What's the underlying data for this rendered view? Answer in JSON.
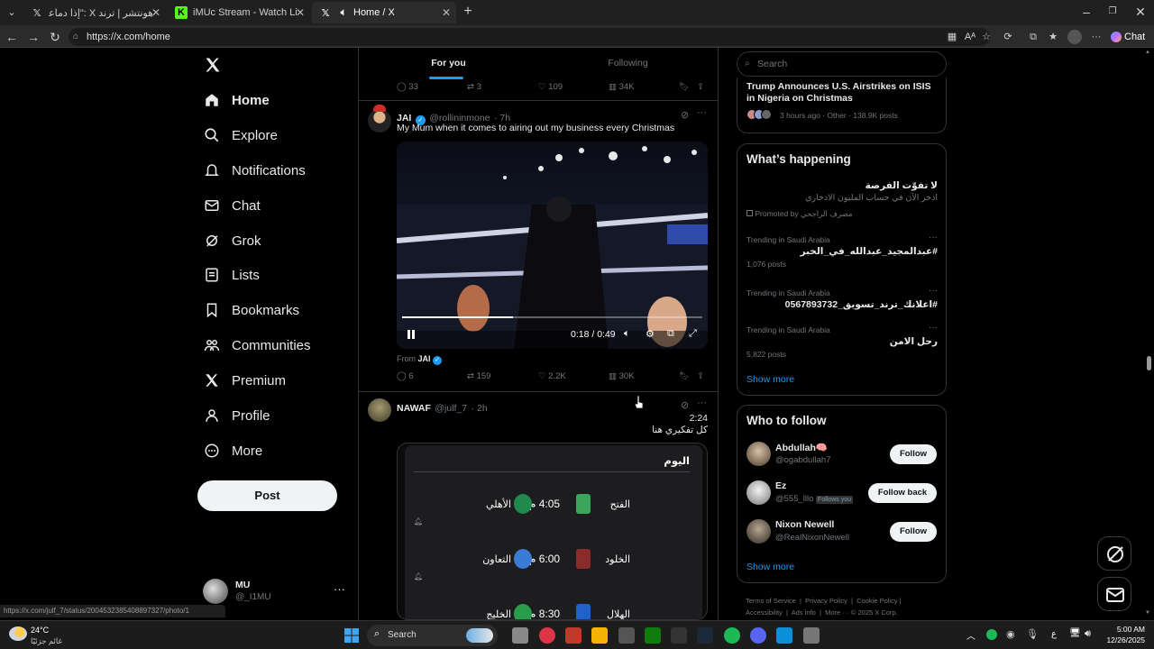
{
  "browser": {
    "tabs": [
      {
        "label": "هونتشر | ترند X :\"إذا دماعك يميز",
        "icon": "X"
      },
      {
        "label": "iMUc Stream - Watch Live on Kick",
        "icon": "K"
      },
      {
        "label": "Home / X",
        "icon": "X"
      }
    ],
    "url": "https://x.com/home",
    "chat_label": "Chat"
  },
  "nav": {
    "items": [
      {
        "label": "Home",
        "icon": "home-icon"
      },
      {
        "label": "Explore",
        "icon": "search-icon"
      },
      {
        "label": "Notifications",
        "icon": "bell-icon"
      },
      {
        "label": "Chat",
        "icon": "mail-icon"
      },
      {
        "label": "Grok",
        "icon": "grok-icon"
      },
      {
        "label": "Lists",
        "icon": "list-icon"
      },
      {
        "label": "Bookmarks",
        "icon": "bookmark-icon"
      },
      {
        "label": "Communities",
        "icon": "people-icon"
      },
      {
        "label": "Premium",
        "icon": "x-logo-icon"
      },
      {
        "label": "Profile",
        "icon": "person-icon"
      },
      {
        "label": "More",
        "icon": "more-circle-icon"
      }
    ],
    "post_label": "Post",
    "account": {
      "name": "MU",
      "handle": "@_I1MU"
    }
  },
  "feed": {
    "tabs": {
      "for_you": "For you",
      "following": "Following"
    },
    "top_actions": {
      "replies": "33",
      "reposts": "3",
      "likes": "109",
      "views": "34K"
    },
    "post1": {
      "name": "JAI",
      "handle": "@rollininmone",
      "time": "· 7h",
      "text": "My Mum when it comes to airing out my business every Christmas",
      "video_time": "0:18 / 0:49",
      "video_progress": 0.37,
      "from_label": "From",
      "from_name": "JAI",
      "replies": "6",
      "reposts": "159",
      "likes": "2.2K",
      "views": "30K"
    },
    "post2": {
      "name": "NAWAF",
      "handle": "@julf_7",
      "time": "· 2h",
      "line1": "2:24",
      "line2": "كل تفكيري هنا",
      "card_title": "اليوم",
      "matches": [
        {
          "home": "الفتح",
          "time": "4:05 م",
          "away": "الأهلي"
        },
        {
          "home": "الخلود",
          "time": "6:00 م",
          "away": "التعاون"
        },
        {
          "home": "الهلال",
          "time": "8:30 م",
          "away": "الخليج"
        }
      ]
    },
    "status_url": "https://x.com/julf_7/status/2004532385408897327/photo/1"
  },
  "right": {
    "search_placeholder": "Search",
    "top_trend": {
      "title": "Trump Announces U.S. Airstrikes on ISIS in Nigeria on Christmas",
      "meta": "3 hours ago · Other · 138.9K posts"
    },
    "whats_happening": {
      "title": "What’s happening",
      "promo": {
        "title": "لا تفوّت الفرصة",
        "desc": "ادخر الآن في حساب المليون الادخاري",
        "promoted": "Promoted by",
        "advertiser": "مصرف الراجحي"
      },
      "trends": [
        {
          "context": "Trending in Saudi Arabia",
          "name": "#عبدالمجيد_عبدالله_في_الخبر",
          "count": "1,076 posts"
        },
        {
          "context": "Trending in Saudi Arabia",
          "name": "#اعلانك_ترند_تسويق_0567893732",
          "count": ""
        },
        {
          "context": "Trending in Saudi Arabia",
          "name": "رحل الامن",
          "count": "5,822 posts"
        }
      ],
      "show_more": "Show more"
    },
    "who_to_follow": {
      "title": "Who to follow",
      "users": [
        {
          "name": "Abdullah🧠",
          "handle": "@ogabdullah7",
          "button": "Follow",
          "badge": ""
        },
        {
          "name": "Ez",
          "handle": "@555_lllo",
          "button": "Follow back",
          "badge": "Follows you"
        },
        {
          "name": "Nixon Newell",
          "handle": "@RealNixonNewell",
          "button": "Follow",
          "badge": ""
        }
      ],
      "show_more": "Show more"
    },
    "footer": [
      "Terms of Service",
      "Privacy Policy",
      "Cookie Policy",
      "Accessibility",
      "Ads info",
      "More ···",
      "© 2025 X Corp."
    ]
  },
  "taskbar": {
    "weather_temp": "24°C",
    "weather_desc": "غائم جزئيًا",
    "search_label": "Search",
    "time": "5:00 AM",
    "date": "12/26/2025",
    "lang": "ع"
  }
}
